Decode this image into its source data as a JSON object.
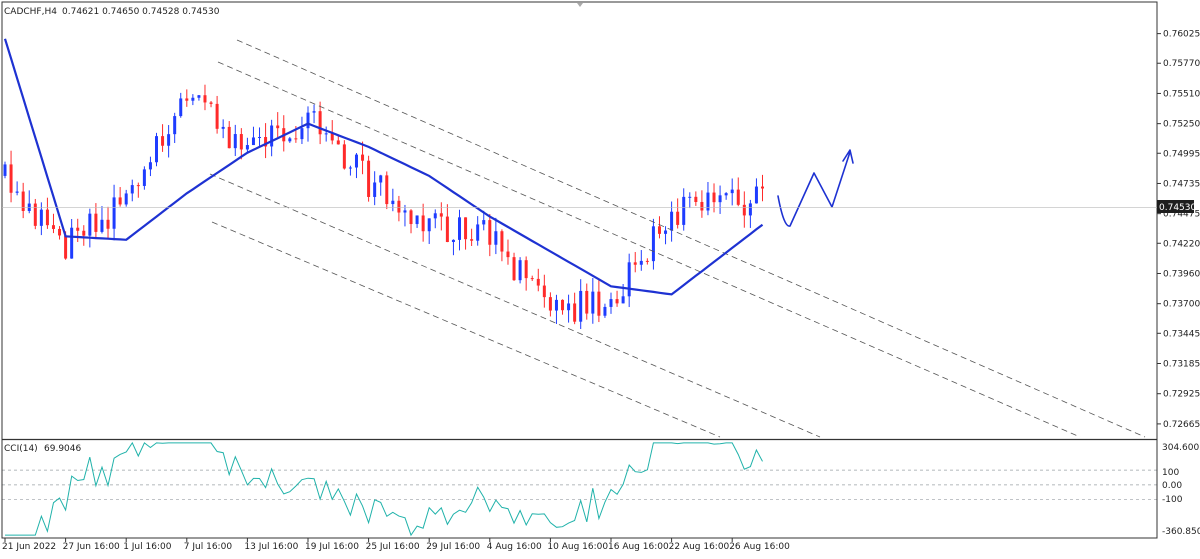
{
  "symbol_header": {
    "symbol": "CADCHF,H4",
    "ohlc": "0.74621 0.74650 0.74528 0.74530"
  },
  "indicator": {
    "name": "CCI(14)",
    "value": "69.9046",
    "max_label": "304.6005",
    "min_label": "-360.8501",
    "levels": [
      "100",
      "0.00",
      "-100"
    ]
  },
  "colors": {
    "bull_candle": "#1e3cff",
    "bear_candle": "#ff2a2a",
    "moving_average": "#1e32d2",
    "cci_line": "#20b2aa",
    "channel_lines": "#555555",
    "current_price_tag": "#1e1e1e"
  },
  "chart_data": [
    {
      "type": "candlestick",
      "title": "CADCHF,H4",
      "ylim": [
        0.72535,
        0.7628
      ],
      "y_ticks": [
        "0.76025",
        "0.75770",
        "0.75510",
        "0.75250",
        "0.74995",
        "0.74735",
        "0.74475",
        "0.74220",
        "0.73960",
        "0.73700",
        "0.73445",
        "0.73185",
        "0.72925",
        "0.72665"
      ],
      "x_ticks": [
        "21 Jun 2022",
        "27 Jun 16:00",
        "1 Jul 16:00",
        "7 Jul 16:00",
        "13 Jul 16:00",
        "19 Jul 16:00",
        "25 Jul 16:00",
        "29 Jul 16:00",
        "4 Aug 16:00",
        "10 Aug 16:00",
        "16 Aug 16:00",
        "22 Aug 16:00",
        "26 Aug 16:00"
      ],
      "current_price": "0.74530",
      "price_path_approx": [
        {
          "x": "21 Jun 2022",
          "y": 0.748
        },
        {
          "x": "27 Jun 16:00",
          "y": 0.742
        },
        {
          "x": "1 Jul 16:00",
          "y": 0.7455
        },
        {
          "x": "7 Jul 16:00",
          "y": 0.7555
        },
        {
          "x": "13 Jul 16:00",
          "y": 0.75
        },
        {
          "x": "19 Jul 16:00",
          "y": 0.753
        },
        {
          "x": "25 Jul 16:00",
          "y": 0.7475
        },
        {
          "x": "29 Jul 16:00",
          "y": 0.744
        },
        {
          "x": "4 Aug 16:00",
          "y": 0.743
        },
        {
          "x": "10 Aug 16:00",
          "y": 0.7365
        },
        {
          "x": "16 Aug 16:00",
          "y": 0.737
        },
        {
          "x": "22 Aug 16:00",
          "y": 0.745
        },
        {
          "x": "26 Aug 16:00",
          "y": 0.7455
        }
      ],
      "series": [
        {
          "type": "line",
          "values_approx": [
            {
              "x": "21 Jun 2022",
              "y": 0.7598
            },
            {
              "x": "27 Jun 16:00",
              "y": 0.7428
            },
            {
              "x": "1 Jul 16:00",
              "y": 0.7425
            },
            {
              "x": "7 Jul 16:00",
              "y": 0.7465
            },
            {
              "x": "13 Jul 16:00",
              "y": 0.75
            },
            {
              "x": "19 Jul 16:00",
              "y": 0.7525
            },
            {
              "x": "25 Jul 16:00",
              "y": 0.7505
            },
            {
              "x": "29 Jul 16:00",
              "y": 0.748
            },
            {
              "x": "4 Aug 16:00",
              "y": 0.7445
            },
            {
              "x": "10 Aug 16:00",
              "y": 0.7415
            },
            {
              "x": "16 Aug 16:00",
              "y": 0.7385
            },
            {
              "x": "22 Aug 16:00",
              "y": 0.7378
            },
            {
              "x": "26 Aug 16:00",
              "y": 0.7418
            }
          ]
        }
      ],
      "annotations": [
        "three parallel descending dashed channel lines",
        "hand-drawn projected path arrow pointing up"
      ]
    },
    {
      "type": "line",
      "title": "CCI(14) 69.9046",
      "ylim": [
        -360.8501,
        304.6005
      ],
      "levels": [
        100,
        0,
        -100
      ]
    }
  ]
}
